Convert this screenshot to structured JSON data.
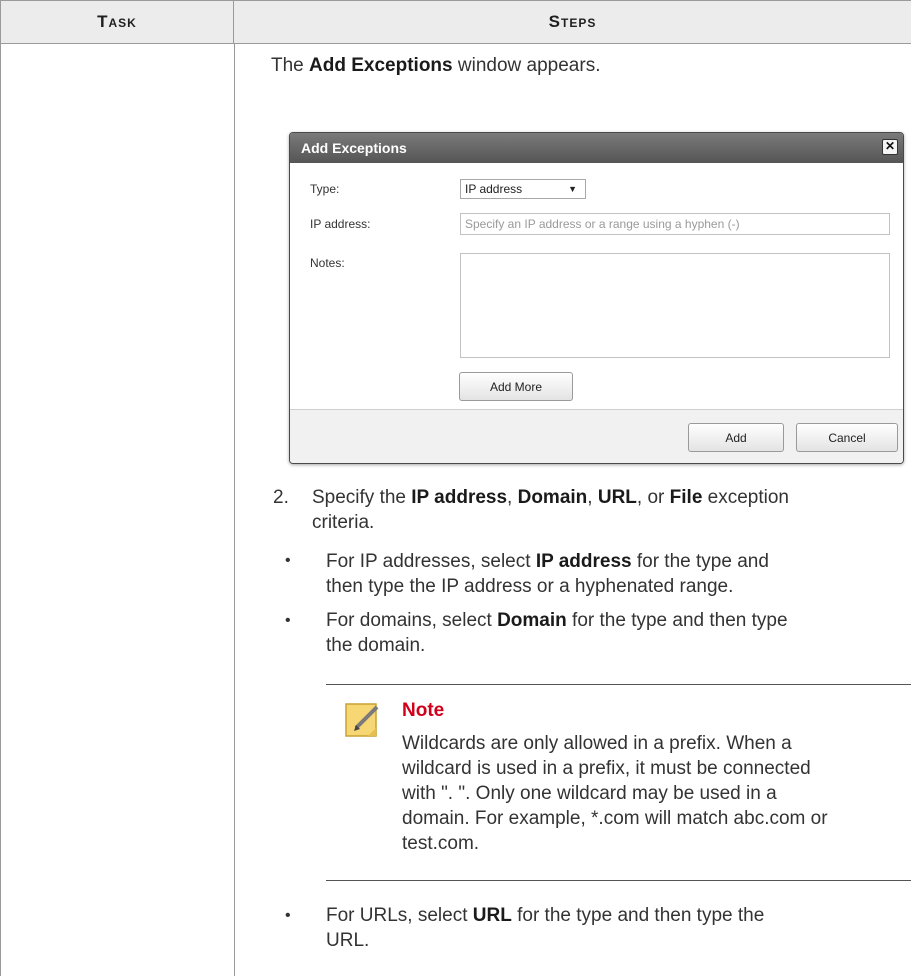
{
  "table": {
    "header_task": "Task",
    "header_steps": "Steps"
  },
  "intro": {
    "pre": "The ",
    "bold": "Add Exceptions",
    "post": " window appears."
  },
  "dialog": {
    "title": "Add Exceptions",
    "close_glyph": "✕",
    "type_label": "Type:",
    "type_value": "IP address",
    "ip_label": "IP address:",
    "ip_placeholder": "Specify an IP address or a range using a hyphen (-)",
    "notes_label": "Notes:",
    "add_more_label": "Add More",
    "add_label": "Add",
    "cancel_label": "Cancel"
  },
  "step2": {
    "number": "2.",
    "t1": "Specify the ",
    "b1": "IP address",
    "t2": ", ",
    "b2": "Domain",
    "t3": ", ",
    "b3": "URL",
    "t4": ", or ",
    "b4": "File",
    "t5": " exception",
    "line2": "criteria."
  },
  "bullets": [
    {
      "glyph": "•",
      "pre": "For IP addresses, select ",
      "bold": "IP address",
      "post": " for the type and",
      "line2": "then type the IP address or a hyphenated range."
    },
    {
      "glyph": "•",
      "pre": "For domains, select ",
      "bold": "Domain",
      "post": " for the type and then type",
      "line2": "the domain."
    },
    {
      "glyph": "•",
      "pre": "For URLs, select ",
      "bold": "URL",
      "post": " for the type and then type the",
      "line2": "URL."
    }
  ],
  "note": {
    "icon": "note-pencil-icon",
    "title": "Note",
    "lines": [
      "Wildcards are only allowed in a prefix. When a",
      "wildcard is used in a prefix, it must be connected",
      "with \". \". Only one wildcard may be used in a",
      "domain. For example, *.com will match abc.com or",
      "test.com."
    ],
    "title_color": "#d0021b"
  }
}
